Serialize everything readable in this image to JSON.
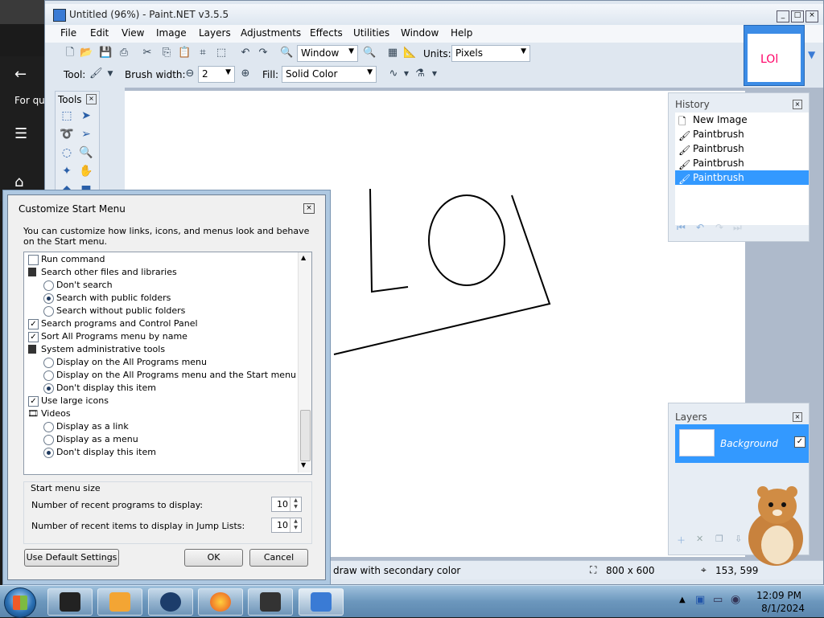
{
  "paint": {
    "title": "Untitled (96%) - Paint.NET v3.5.5",
    "menu": [
      "File",
      "Edit",
      "View",
      "Image",
      "Layers",
      "Adjustments",
      "Effects",
      "Utilities",
      "Window",
      "Help"
    ],
    "toolbar": {
      "zoom_value": "Window",
      "units_label": "Units:",
      "units_value": "Pixels",
      "tool_label": "Tool:",
      "brush_width_label": "Brush width:",
      "brush_width_value": "2",
      "fill_label": "Fill:",
      "fill_value": "Solid Color"
    },
    "tools_panel": {
      "title": "Tools"
    },
    "history": {
      "title": "History",
      "items": [
        "New Image",
        "Paintbrush",
        "Paintbrush",
        "Paintbrush",
        "Paintbrush"
      ],
      "selected_index": 4
    },
    "layers": {
      "title": "Layers",
      "items": [
        "Background"
      ]
    },
    "status": {
      "hint": "draw with secondary color",
      "image_size": "800 x 600",
      "cursor_pos": "153, 599"
    },
    "canvas_text": "LOl"
  },
  "dialog": {
    "title": "Customize Start Menu",
    "description": "You can customize how links, icons, and menus look and behave on the Start menu.",
    "options": [
      {
        "kind": "checkbox",
        "label": "Run command",
        "checked": false,
        "indent": 0
      },
      {
        "kind": "header",
        "label": "Search other files and libraries",
        "indent": 0
      },
      {
        "kind": "radio",
        "label": "Don't search",
        "checked": false,
        "indent": 1
      },
      {
        "kind": "radio",
        "label": "Search with public folders",
        "checked": true,
        "indent": 1
      },
      {
        "kind": "radio",
        "label": "Search without public folders",
        "checked": false,
        "indent": 1
      },
      {
        "kind": "checkbox",
        "label": "Search programs and Control Panel",
        "checked": true,
        "indent": 0
      },
      {
        "kind": "checkbox",
        "label": "Sort All Programs menu by name",
        "checked": true,
        "indent": 0
      },
      {
        "kind": "header",
        "label": "System administrative tools",
        "indent": 0
      },
      {
        "kind": "radio",
        "label": "Display on the All Programs menu",
        "checked": false,
        "indent": 1
      },
      {
        "kind": "radio",
        "label": "Display on the All Programs menu and the Start menu",
        "checked": false,
        "indent": 1
      },
      {
        "kind": "radio",
        "label": "Don't display this item",
        "checked": true,
        "indent": 1
      },
      {
        "kind": "checkbox",
        "label": "Use large icons",
        "checked": true,
        "indent": 0
      },
      {
        "kind": "header",
        "label": "Videos",
        "indent": 0
      },
      {
        "kind": "radio",
        "label": "Display as a link",
        "checked": false,
        "indent": 1
      },
      {
        "kind": "radio",
        "label": "Display as a menu",
        "checked": false,
        "indent": 1
      },
      {
        "kind": "radio",
        "label": "Don't display this item",
        "checked": true,
        "indent": 1
      }
    ],
    "start_menu_size": {
      "legend": "Start menu size",
      "recent_programs_label": "Number of recent programs to display:",
      "recent_programs_value": "10",
      "recent_items_label": "Number of recent items to display in Jump Lists:",
      "recent_items_value": "10"
    },
    "buttons": {
      "default": "Use Default Settings",
      "ok": "OK",
      "cancel": "Cancel"
    }
  },
  "background": {
    "side_text": "For qui"
  },
  "taskbar": {
    "time": "12:09 PM",
    "date": "8/1/2024"
  }
}
